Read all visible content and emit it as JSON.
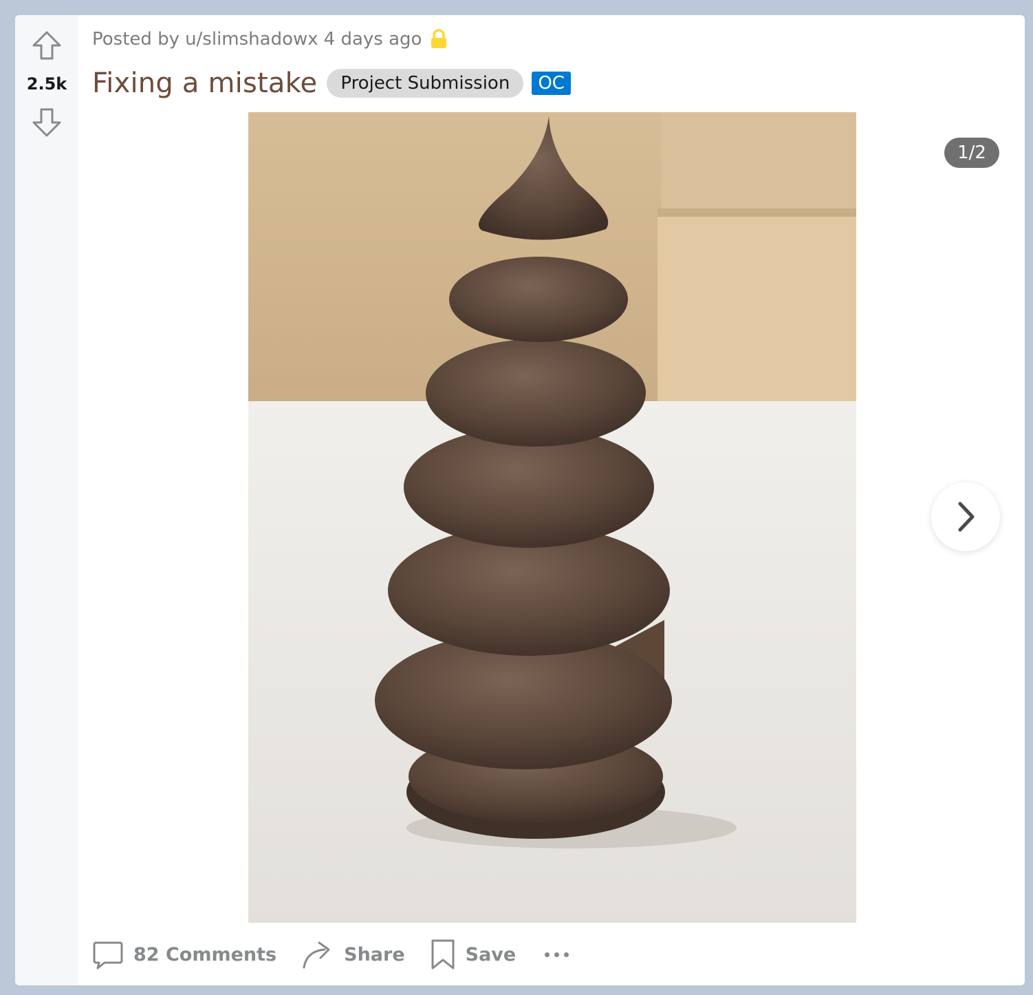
{
  "post": {
    "vote_count": "2.5k",
    "posted_by_prefix": "Posted by",
    "author": "u/slimshadowx",
    "age": "4 days ago",
    "title": "Fixing a mistake",
    "flair": "Project Submission",
    "oc_tag": "OC"
  },
  "gallery": {
    "counter": "1/2",
    "current": 1,
    "total": 2
  },
  "actions": {
    "comments": "82 Comments",
    "share": "Share",
    "save": "Save"
  },
  "icons": {
    "upvote": "arrow-up-icon",
    "downvote": "arrow-down-icon",
    "lock": "lock-icon",
    "next": "chevron-right-icon",
    "comment": "comment-bubble-icon",
    "share": "share-arrow-icon",
    "save": "bookmark-icon",
    "more": "ellipsis-icon"
  },
  "colors": {
    "title": "#6e4b3a",
    "oc_badge": "#0079d3",
    "flair_bg": "#dadada",
    "lock": "#ffd635",
    "page_bg": "#bac8d8"
  }
}
